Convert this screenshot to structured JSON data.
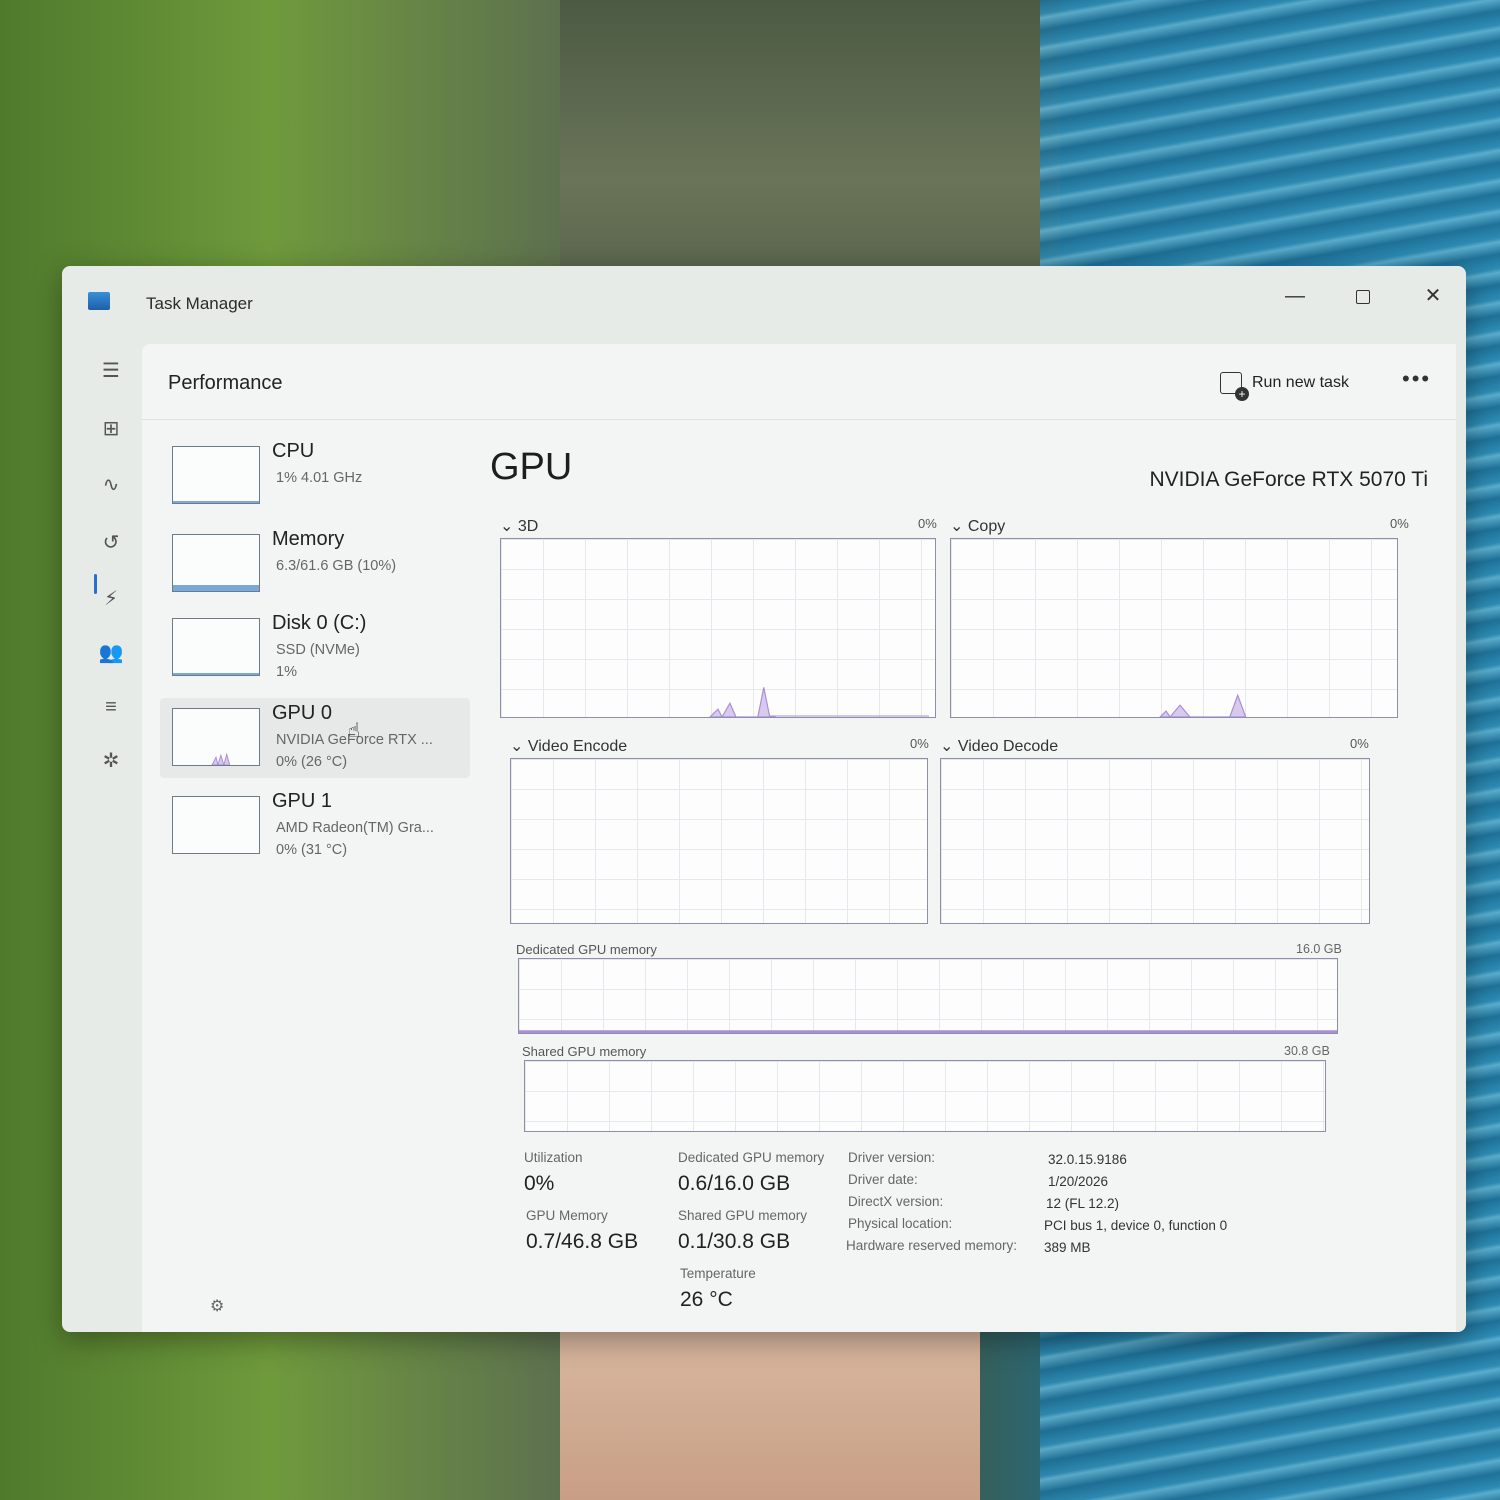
{
  "window": {
    "title": "Task Manager",
    "minimize_glyph": "—",
    "close_glyph": "✕"
  },
  "nav": {
    "menu_icon": "☰",
    "items": [
      {
        "name": "processes-icon",
        "glyph": "⊞"
      },
      {
        "name": "performance-icon",
        "glyph": "∿"
      },
      {
        "name": "app-history-icon",
        "glyph": "↺"
      },
      {
        "name": "startup-apps-icon",
        "glyph": "⚡"
      },
      {
        "name": "users-icon",
        "glyph": "👥"
      },
      {
        "name": "details-icon",
        "glyph": "≡"
      },
      {
        "name": "services-icon",
        "glyph": "✲"
      }
    ],
    "settings_icon": "⚙"
  },
  "header": {
    "title": "Performance",
    "run_new_task": "Run new task",
    "more_glyph": "•••"
  },
  "devices": [
    {
      "name": "CPU",
      "line1": "1%  4.01 GHz",
      "line2": "",
      "usage": 0.01
    },
    {
      "name": "Memory",
      "line1": "6.3/61.6 GB (10%)",
      "line2": "",
      "usage": 0.1
    },
    {
      "name": "Disk 0 (C:)",
      "line1": "SSD (NVMe)",
      "line2": "1%",
      "usage": 0.01
    },
    {
      "name": "GPU 0",
      "line1": "NVIDIA GeForce RTX ...",
      "line2": "0%  (26 °C)",
      "usage": 0.0
    },
    {
      "name": "GPU 1",
      "line1": "AMD Radeon(TM) Gra...",
      "line2": "0%  (31 °C)",
      "usage": 0.0
    }
  ],
  "gpu": {
    "title": "GPU",
    "model": "NVIDIA GeForce RTX 5070 Ti",
    "engines": [
      {
        "label": "3D",
        "percent": "0%"
      },
      {
        "label": "Copy",
        "percent": "0%"
      },
      {
        "label": "Video Encode",
        "percent": "0%"
      },
      {
        "label": "Video Decode",
        "percent": "0%"
      }
    ],
    "dedicated_memory": {
      "label": "Dedicated GPU memory",
      "max": "16.0 GB",
      "fraction": 0.0375
    },
    "shared_memory": {
      "label": "Shared GPU memory",
      "max": "30.8 GB",
      "fraction": 0.003
    },
    "stats": {
      "utilization_label": "Utilization",
      "utilization_value": "0%",
      "dedicated_label": "Dedicated GPU memory",
      "dedicated_value": "0.6/16.0 GB",
      "gpu_memory_label": "GPU Memory",
      "gpu_memory_value": "0.7/46.8 GB",
      "shared_label": "Shared GPU memory",
      "shared_value": "0.1/30.8 GB",
      "temperature_label": "Temperature",
      "temperature_value": "26 °C"
    },
    "details": [
      {
        "key": "Driver version:",
        "value": "32.0.15.9186"
      },
      {
        "key": "Driver date:",
        "value": "1/20/2026"
      },
      {
        "key": "DirectX version:",
        "value": "12 (FL 12.2)"
      },
      {
        "key": "Physical location:",
        "value": "PCI bus 1, device 0, function 0"
      },
      {
        "key": "Hardware reserved memory:",
        "value": "389 MB"
      }
    ]
  },
  "colors": {
    "accent": "#2b6fd1",
    "gpu_graph": "#a98fd6",
    "gpu_graph_fill": "#d8c9ef",
    "memory_graph": "#7aa8d8"
  }
}
